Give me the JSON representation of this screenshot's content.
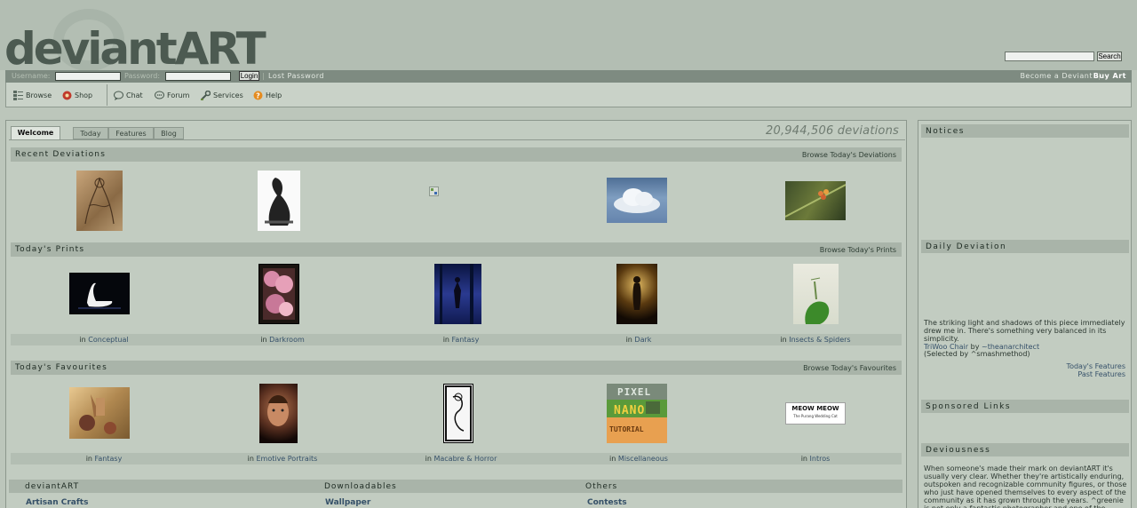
{
  "header": {
    "logo_text": "deviantART",
    "search": {
      "value": "",
      "button_label": "Search"
    }
  },
  "loginbar": {
    "username_label": "Username:",
    "password_label": "Password:",
    "login_label": "Login",
    "lost_password": "Lost Password",
    "become_deviant": "Become a Deviant",
    "separator": "|",
    "buy_art": "Buy Art"
  },
  "nav": {
    "items": [
      {
        "label": "Browse",
        "icon": "browse-icon"
      },
      {
        "label": "Shop",
        "icon": "shop-icon"
      },
      {
        "label": "Chat",
        "icon": "chat-icon"
      },
      {
        "label": "Forum",
        "icon": "forum-icon"
      },
      {
        "label": "Services",
        "icon": "services-icon"
      },
      {
        "label": "Help",
        "icon": "help-icon"
      }
    ]
  },
  "main": {
    "deviation_count": "20,944,506 deviations",
    "tabs": [
      {
        "label": "Welcome",
        "active": true
      },
      {
        "label": "Today",
        "active": false
      },
      {
        "label": "Features",
        "active": false
      },
      {
        "label": "Blog",
        "active": false
      }
    ],
    "recent": {
      "title": "Recent Deviations",
      "browse": "Browse Today's Deviations"
    },
    "prints": {
      "title": "Today's Prints",
      "browse": "Browse Today's Prints",
      "categories": [
        "Conceptual",
        "Darkroom",
        "Fantasy",
        "Dark",
        "Insects & Spiders"
      ]
    },
    "favourites": {
      "title": "Today's Favourites",
      "browse": "Browse Today's Favourites",
      "categories": [
        "Fantasy",
        "Emotive Portraits",
        "Macabre & Horror",
        "Miscellaneous",
        "Intros"
      ]
    },
    "in_label": "in",
    "thumb_text": {
      "pixel": "PIXEL",
      "nano": "NANO",
      "tutorial": "TUTORIAL",
      "meow_title": "MEOW MEOW",
      "meow_subtitle": "The Purang Wedding Cat"
    },
    "footer": {
      "columns": [
        "deviantART",
        "Downloadables",
        "Others"
      ],
      "links": [
        "Artisan Crafts",
        "Wallpaper",
        "Contests"
      ]
    }
  },
  "sidebar": {
    "notices_title": "Notices",
    "daily_title": "Daily Deviation",
    "daily_text": "The striking light and shadows of this piece immediately drew me in. There's something very balanced in its simplicity.",
    "daily_work": "TriWoo Chair",
    "daily_by": "by",
    "daily_artist": "~theanarchitect",
    "selected_by": "(Selected by ^smashmethod)",
    "todays_features": "Today's Features",
    "past_features": "Past Features",
    "sponsored_title": "Sponsored Links",
    "deviousness_title": "Deviousness",
    "deviousness_text": "When someone's made their mark on deviantART it's usually very clear. Whether they're artistically enduring, outspoken and recognizable community figures, or those who just have opened themselves to every aspect of the community as it has grown through the years. ^greenie is not only a fantastic photographer and one of the major organizers for devMeets in"
  },
  "colors": {
    "background": "#bcc6bb",
    "header": "#b3beb3",
    "loginbar": "#7e8b81",
    "section_header": "#a9b4a9",
    "link": "#36516a"
  }
}
